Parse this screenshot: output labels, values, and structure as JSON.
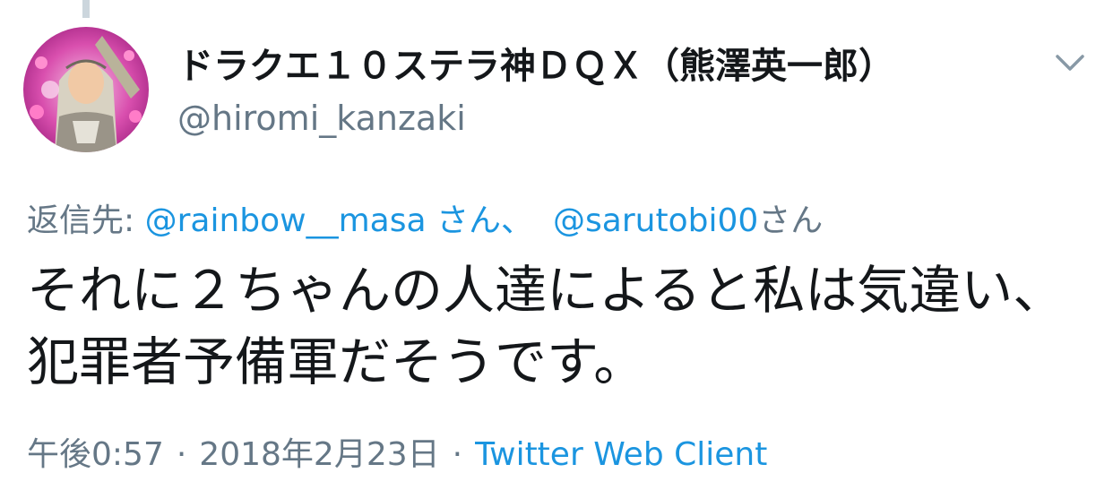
{
  "tweet": {
    "display_name": "ドラクエ１０ステラ神ＤＱＸ（熊澤英一郎）",
    "handle": "@hiromi_kanzaki",
    "avatar_icon": "user-avatar-icon",
    "menu_icon": "chevron-down-icon",
    "reply_prefix": "返信先:",
    "reply_mention_1": "@rainbow__masa",
    "reply_suffix_1": "さん、",
    "reply_mention_2": "@sarutobi00",
    "reply_suffix_2": "さん",
    "text": "それに２ちゃんの人達によると私は気違い、犯罪者予備軍だそうです。",
    "time": "午後0:57",
    "separator": "·",
    "date": "2018年2月23日",
    "client": "Twitter Web Client"
  },
  "colors": {
    "text_primary": "#14171a",
    "text_secondary": "#657786",
    "link": "#1b95e0",
    "thread_line": "#ccd6dd"
  }
}
